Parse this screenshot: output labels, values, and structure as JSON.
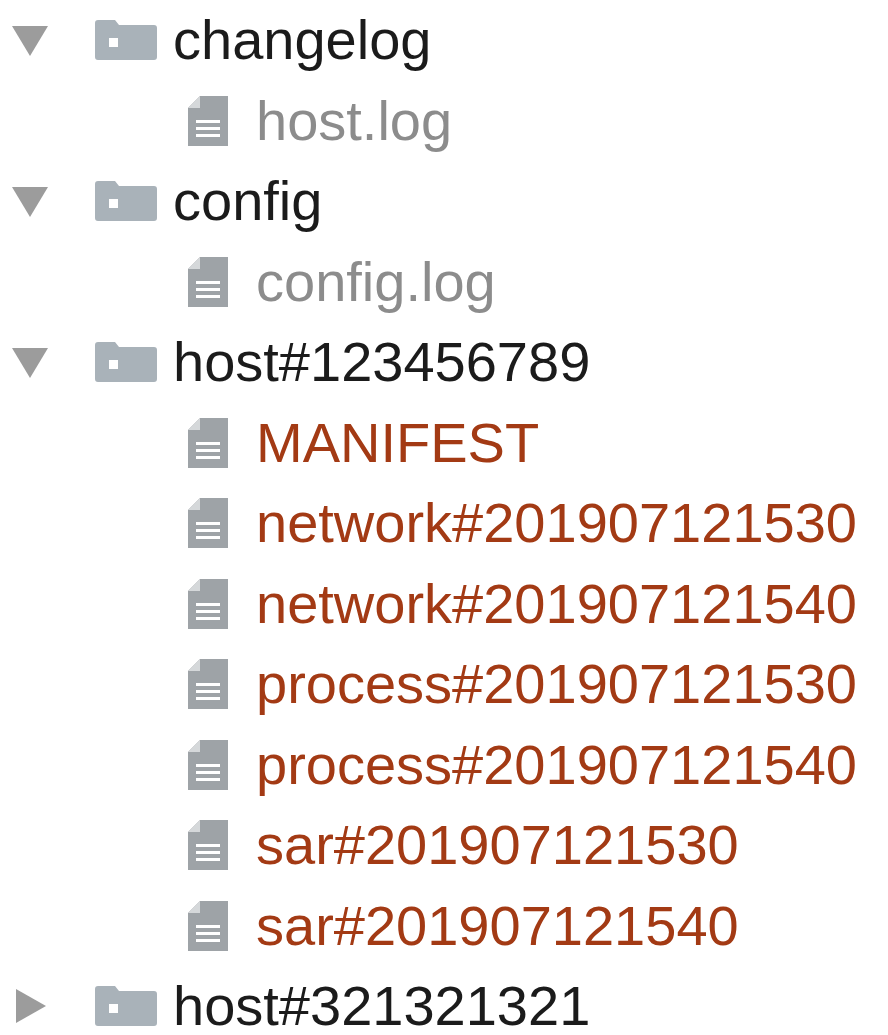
{
  "tree": [
    {
      "name": "changelog",
      "expanded": true,
      "children": [
        {
          "name": "host.log",
          "color": "#8c8c8c"
        }
      ]
    },
    {
      "name": "config",
      "expanded": true,
      "children": [
        {
          "name": "config.log",
          "color": "#8c8c8c"
        }
      ]
    },
    {
      "name": "host#123456789",
      "expanded": true,
      "children": [
        {
          "name": "MANIFEST",
          "color": "#a33a14"
        },
        {
          "name": "network#201907121530",
          "color": "#a33a14"
        },
        {
          "name": "network#201907121540",
          "color": "#a33a14"
        },
        {
          "name": "process#201907121530",
          "color": "#a33a14"
        },
        {
          "name": "process#201907121540",
          "color": "#a33a14"
        },
        {
          "name": "sar#201907121530",
          "color": "#a33a14"
        },
        {
          "name": "sar#201907121540",
          "color": "#a33a14"
        }
      ]
    },
    {
      "name": "host#321321321",
      "expanded": false
    }
  ]
}
